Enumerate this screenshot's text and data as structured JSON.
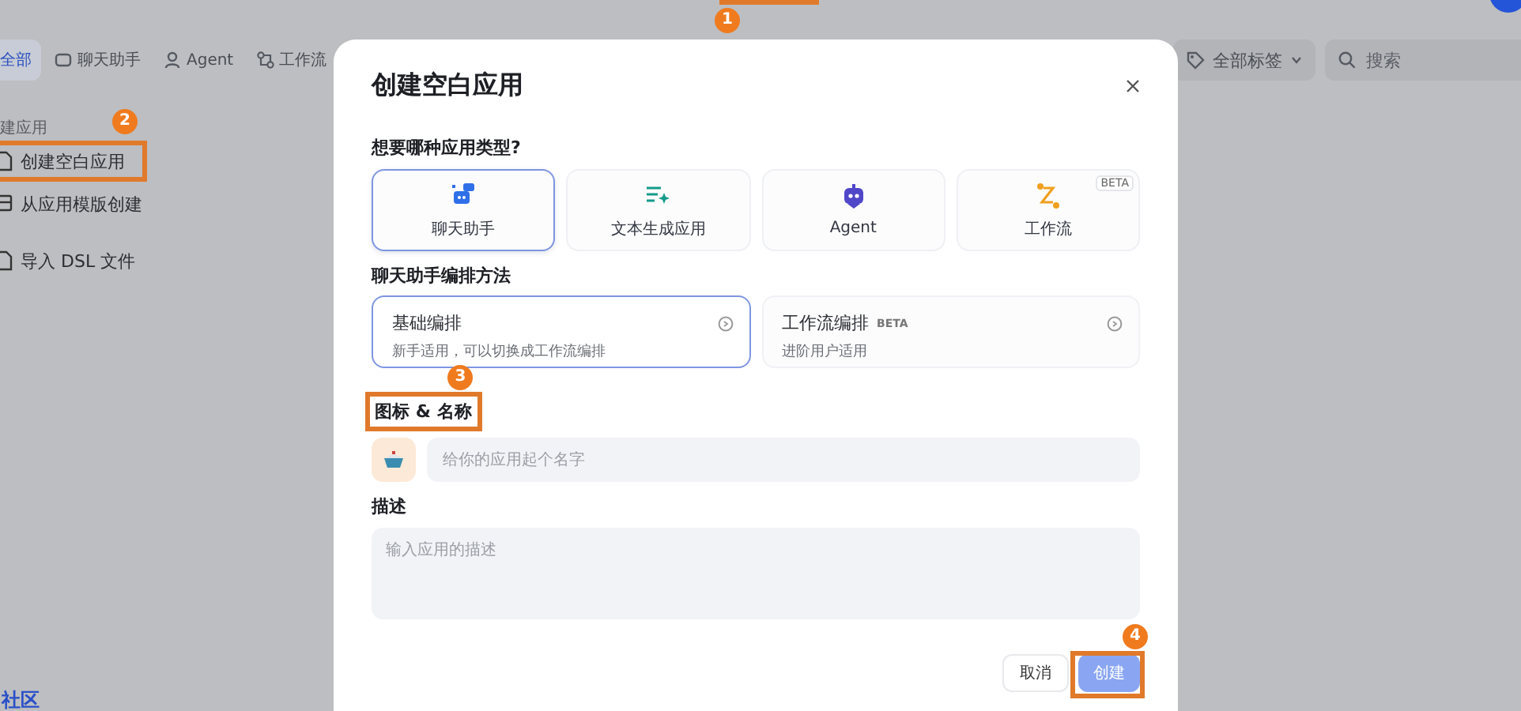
{
  "header": {
    "annotation": "1"
  },
  "filter_tabs": [
    {
      "label": "全部",
      "selected": true,
      "kind": "all"
    },
    {
      "label": "聊天助手",
      "selected": false,
      "kind": "chat"
    },
    {
      "label": "Agent",
      "selected": false,
      "kind": "agent"
    },
    {
      "label": "工作流",
      "selected": false,
      "kind": "workflow"
    }
  ],
  "tag_filter": {
    "label": "全部标签"
  },
  "search": {
    "placeholder": "搜索"
  },
  "create_panel": {
    "title": "建应用",
    "items": [
      {
        "label": "创建空白应用",
        "kind": "blank",
        "annotation": "2"
      },
      {
        "label": "从应用模版创建",
        "kind": "template"
      },
      {
        "label": "导入 DSL 文件",
        "kind": "import"
      }
    ]
  },
  "community_link": "社区",
  "dialog": {
    "title": "创建空白应用",
    "type_question": "想要哪种应用类型?",
    "app_types": [
      {
        "label": "聊天助手",
        "kind": "chat",
        "selected": true
      },
      {
        "label": "文本生成应用",
        "kind": "text",
        "selected": false
      },
      {
        "label": "Agent",
        "kind": "agent",
        "selected": false
      },
      {
        "label": "工作流",
        "kind": "workflow",
        "selected": false,
        "badge": "BETA"
      }
    ],
    "method_title": "聊天助手编排方法",
    "methods": [
      {
        "title": "基础编排",
        "description": "新手适用，可以切换成工作流编排",
        "selected": true
      },
      {
        "title": "工作流编排",
        "badge": "BETA",
        "description": "进阶用户适用",
        "selected": false
      }
    ],
    "name_label": "图标 & 名称",
    "name_annotation": "3",
    "name_placeholder": "给你的应用起个名字",
    "description_label": "描述",
    "description_placeholder": "输入应用的描述",
    "cancel": "取消",
    "create": "创建",
    "create_annotation": "4"
  }
}
